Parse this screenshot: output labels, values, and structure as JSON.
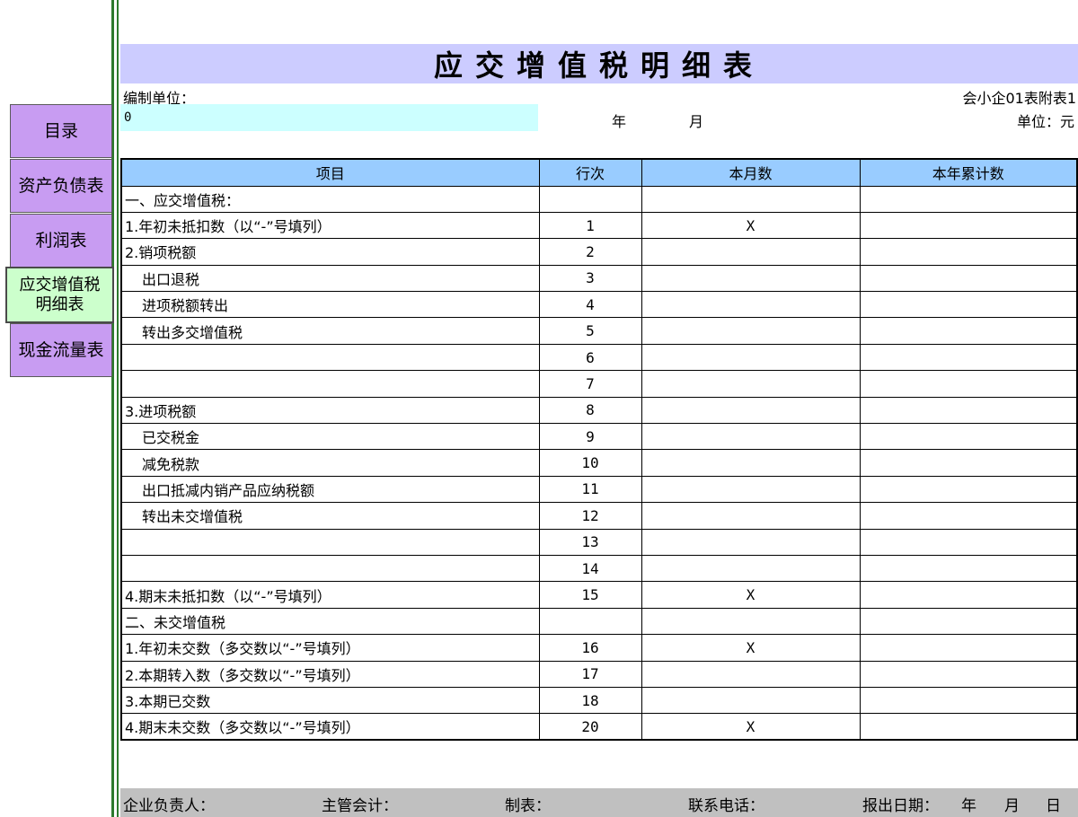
{
  "nav": {
    "items": [
      {
        "label": "目录",
        "active": false
      },
      {
        "label": "资产负债表",
        "active": false
      },
      {
        "label": "利润表",
        "active": false
      },
      {
        "label": "应交增值税\n明细表",
        "active": true
      },
      {
        "label": "现金流量表",
        "active": false
      }
    ]
  },
  "sheet": {
    "title": "应交增值税明细表",
    "unit_label": "编制单位：",
    "unit_value": "0",
    "form_code": "会小企01表附表1",
    "year_label": "年",
    "month_label": "月",
    "currency_label": "单位：元"
  },
  "table": {
    "headers": [
      "项目",
      "行次",
      "本月数",
      "本年累计数"
    ],
    "rows": [
      {
        "item": "一、应交增值税：",
        "line": "",
        "month": "",
        "ytd": "",
        "indent": false
      },
      {
        "item": "1.年初未抵扣数（以“-”号填列）",
        "line": "1",
        "month": "X",
        "ytd": "",
        "indent": false
      },
      {
        "item": "2.销项税额",
        "line": "2",
        "month": "",
        "ytd": "",
        "indent": false
      },
      {
        "item": "出口退税",
        "line": "3",
        "month": "",
        "ytd": "",
        "indent": true
      },
      {
        "item": "进项税额转出",
        "line": "4",
        "month": "",
        "ytd": "",
        "indent": true
      },
      {
        "item": "转出多交增值税",
        "line": "5",
        "month": "",
        "ytd": "",
        "indent": true
      },
      {
        "item": "",
        "line": "6",
        "month": "",
        "ytd": "",
        "indent": false
      },
      {
        "item": "",
        "line": "7",
        "month": "",
        "ytd": "",
        "indent": false
      },
      {
        "item": "3.进项税额",
        "line": "8",
        "month": "",
        "ytd": "",
        "indent": false
      },
      {
        "item": "已交税金",
        "line": "9",
        "month": "",
        "ytd": "",
        "indent": true
      },
      {
        "item": "减免税款",
        "line": "10",
        "month": "",
        "ytd": "",
        "indent": true
      },
      {
        "item": "出口抵减内销产品应纳税额",
        "line": "11",
        "month": "",
        "ytd": "",
        "indent": true
      },
      {
        "item": "转出未交增值税",
        "line": "12",
        "month": "",
        "ytd": "",
        "indent": true
      },
      {
        "item": "",
        "line": "13",
        "month": "",
        "ytd": "",
        "indent": false
      },
      {
        "item": "",
        "line": "14",
        "month": "",
        "ytd": "",
        "indent": false
      },
      {
        "item": "4.期末未抵扣数（以“-”号填列）",
        "line": "15",
        "month": "X",
        "ytd": "",
        "indent": false
      },
      {
        "item": "二、未交增值税",
        "line": "",
        "month": "",
        "ytd": "",
        "indent": false
      },
      {
        "item": "1.年初未交数（多交数以“-”号填列）",
        "line": "16",
        "month": "X",
        "ytd": "",
        "indent": false
      },
      {
        "item": "2.本期转入数（多交数以“-”号填列）",
        "line": "17",
        "month": "",
        "ytd": "",
        "indent": false
      },
      {
        "item": "3.本期已交数",
        "line": "18",
        "month": "",
        "ytd": "",
        "indent": false
      },
      {
        "item": "4.期末未交数（多交数以“-”号填列）",
        "line": "20",
        "month": "X",
        "ytd": "",
        "indent": false
      }
    ]
  },
  "footer": {
    "head": "企业负责人：",
    "accountant": "主管会计：",
    "preparer": "制表：",
    "phone": "联系电话：",
    "date": "报出日期：",
    "year": "年",
    "month": "月",
    "day": "日"
  },
  "colors": {
    "nav_button": "#c89cf2",
    "nav_active": "#ccffcc",
    "title_band": "#ccccff",
    "header_row": "#99ccff",
    "input_fill": "#ccffff",
    "footer_band": "#c0c0c0",
    "divider": "#2d7a2d"
  }
}
